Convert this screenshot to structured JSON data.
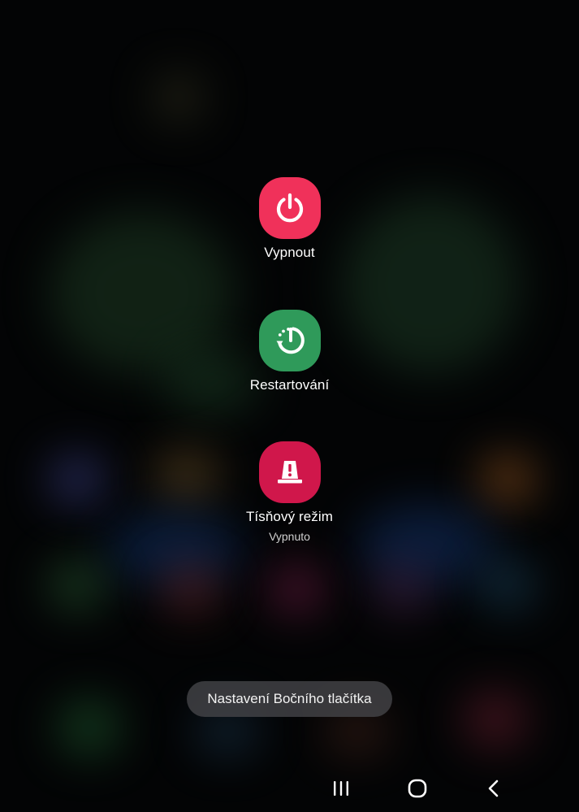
{
  "power_menu": {
    "options": [
      {
        "label": "Vypnout",
        "icon": "power-icon",
        "color": "#f0315a"
      },
      {
        "label": "Restartování",
        "icon": "restart-icon",
        "color": "#2f9a5a"
      },
      {
        "label": "Tísňový režim",
        "status": "Vypnuto",
        "icon": "emergency-siren-icon",
        "color": "#d0174b"
      }
    ],
    "side_key_settings_label": "Nastavení Bočního tlačítka"
  },
  "navigation_bar": {
    "recents": "recents-icon",
    "home": "home-icon",
    "back": "back-icon"
  }
}
